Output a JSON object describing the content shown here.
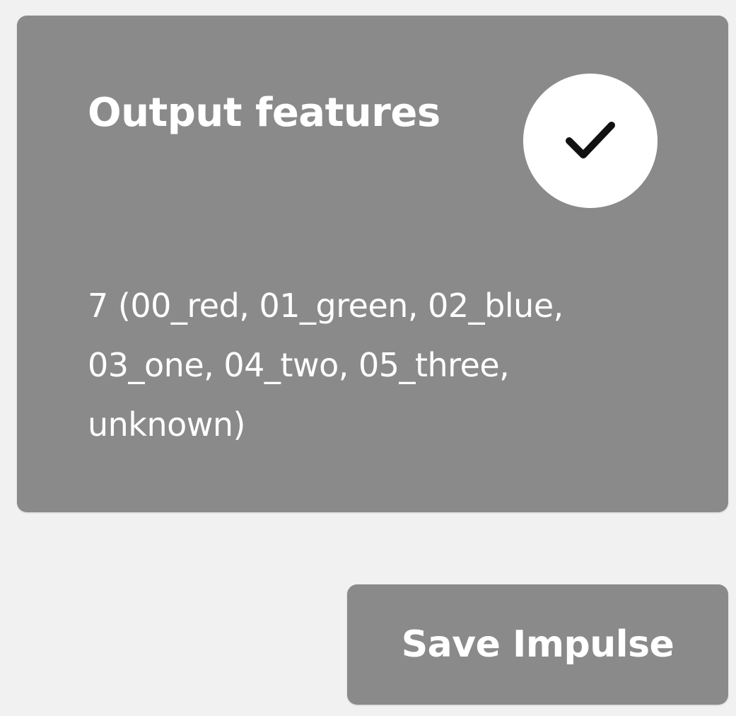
{
  "card": {
    "title": "Output features",
    "description": "7 (00_red, 01_green, 02_blue, 03_one, 04_two, 05_three, unknown)"
  },
  "status": {
    "icon": "checkmark-icon"
  },
  "actions": {
    "save_label": "Save Impulse"
  },
  "colors": {
    "background": "#f1f1f1",
    "card": "#8a8a8a",
    "button": "#8a8a8a",
    "text": "#ffffff",
    "check_circle": "#ffffff",
    "check_mark": "#111111"
  }
}
